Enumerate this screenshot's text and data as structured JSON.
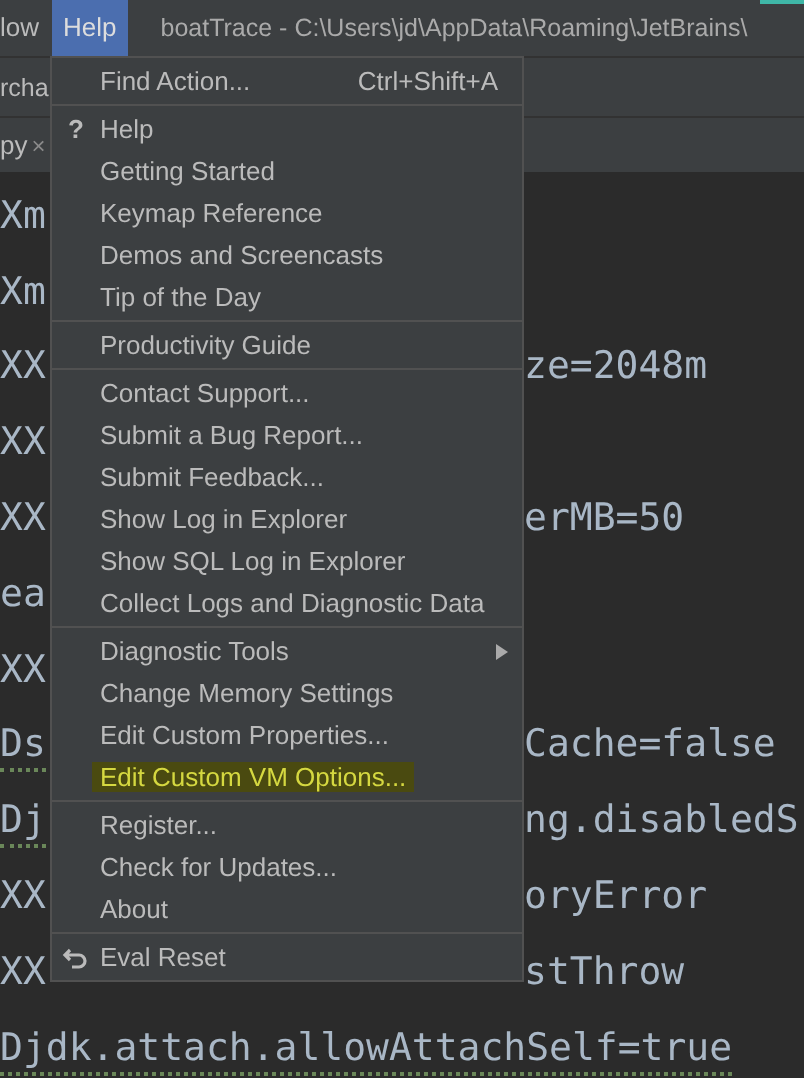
{
  "menu_bar": [
    {
      "label": "low",
      "selected": false
    },
    {
      "label": "Help",
      "selected": true
    }
  ],
  "window": {
    "title": "boatTrace - C:\\Users\\jd\\AppData\\Roaming\\JetBrains\\"
  },
  "toolbar": {
    "label": "rcha"
  },
  "tabs": [
    {
      "label": "py",
      "close": "×",
      "selected": false
    }
  ],
  "editor": {
    "lines": [
      {
        "left": "Xm",
        "typo": false
      },
      {
        "left": "Xm",
        "typo": false
      },
      {
        "left": "XX",
        "right": "ze=2048m",
        "typo": false
      },
      {
        "left": "XX",
        "typo": false
      },
      {
        "left": "XX",
        "right": "erMB=50",
        "typo": false
      },
      {
        "left": "ea",
        "typo": false
      },
      {
        "left": "XX",
        "typo": false
      },
      {
        "left": "Ds",
        "right": "Cache=false",
        "typo": true
      },
      {
        "left": "Dj",
        "right": "ng.disabledS",
        "typo": true
      },
      {
        "left": "XX",
        "right": "oryError",
        "typo": false
      },
      {
        "left": "XX",
        "right": "stThrow",
        "typo": false
      },
      {
        "left": "Djdk.attach.allowAttachSelf=true",
        "typo": true
      }
    ]
  },
  "help_menu": {
    "groups": [
      [
        {
          "kind": "action",
          "label": "Find Action...",
          "shortcut": "Ctrl+Shift+A",
          "highlighted": false
        }
      ],
      [
        {
          "kind": "help",
          "label": "Help",
          "icon": "?",
          "highlighted": false
        },
        {
          "kind": "action",
          "label": "Getting Started",
          "highlighted": false
        },
        {
          "kind": "action",
          "label": "Keymap Reference",
          "highlighted": false
        },
        {
          "kind": "action",
          "label": "Demos and Screencasts",
          "highlighted": false
        },
        {
          "kind": "action",
          "label": "Tip of the Day",
          "highlighted": false
        }
      ],
      [
        {
          "kind": "action",
          "label": "Productivity Guide",
          "highlighted": false
        }
      ],
      [
        {
          "kind": "action",
          "label": "Contact Support...",
          "highlighted": false
        },
        {
          "kind": "action",
          "label": "Submit a Bug Report...",
          "highlighted": false
        },
        {
          "kind": "action",
          "label": "Submit Feedback...",
          "highlighted": false
        },
        {
          "kind": "action",
          "label": "Show Log in Explorer",
          "highlighted": false
        },
        {
          "kind": "action",
          "label": "Show SQL Log in Explorer",
          "highlighted": false
        },
        {
          "kind": "action",
          "label": "Collect Logs and Diagnostic Data",
          "highlighted": false
        }
      ],
      [
        {
          "kind": "submenu",
          "label": "Diagnostic Tools",
          "highlighted": false
        },
        {
          "kind": "action",
          "label": "Change Memory Settings",
          "highlighted": false
        },
        {
          "kind": "action",
          "label": "Edit Custom Properties...",
          "highlighted": false
        },
        {
          "kind": "action",
          "label": "Edit Custom VM Options...",
          "highlighted": true
        }
      ],
      [
        {
          "kind": "action",
          "label": "Register...",
          "highlighted": false
        },
        {
          "kind": "action",
          "label": "Check for Updates...",
          "highlighted": false
        },
        {
          "kind": "action",
          "label": "About",
          "highlighted": false
        }
      ],
      [
        {
          "kind": "reset",
          "label": "Eval Reset",
          "highlighted": false
        }
      ]
    ]
  }
}
